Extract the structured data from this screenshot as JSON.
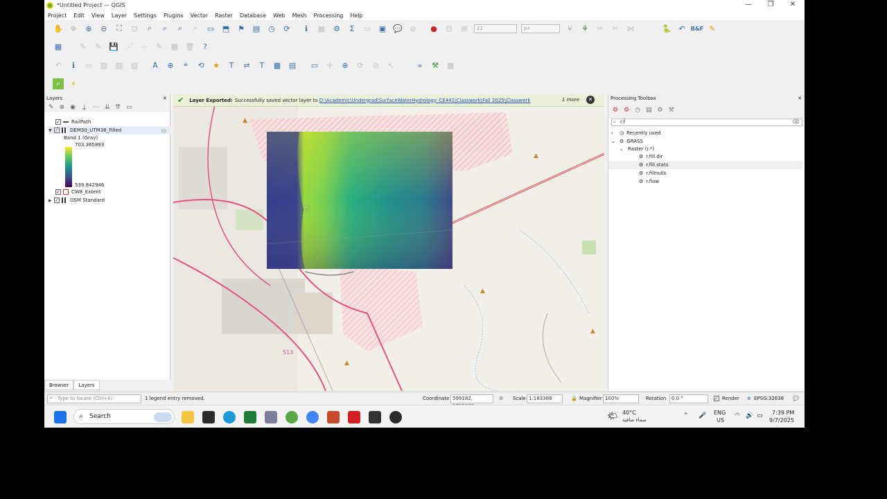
{
  "window": {
    "title": "*Untitled Project — QGIS"
  },
  "menu": [
    "Project",
    "Edit",
    "View",
    "Layer",
    "Settings",
    "Plugins",
    "Vector",
    "Raster",
    "Database",
    "Web",
    "Mesh",
    "Processing",
    "Help"
  ],
  "toolbar": {
    "font_size_value": "12",
    "unit": "px"
  },
  "layers": {
    "title": "Layers",
    "items": [
      {
        "name": "RailPath",
        "checked": true
      },
      {
        "name": "DEM30_UTM38_Filled",
        "checked": true
      },
      {
        "name": "CW8_Extent",
        "checked": true
      },
      {
        "name": "OSM Standard",
        "checked": true
      }
    ],
    "band": "Band 1 (Gray)",
    "ramp_max": "703.365893",
    "ramp_min": "539.842946"
  },
  "bottom_tabs": [
    "Browser",
    "Layers"
  ],
  "message": {
    "title": "Layer Exported:",
    "text": "Successfully saved vector layer to",
    "link": "D:\\Academic\\Undergrad\\SurfaceWaterHydrology_CE441\\Classwork\\Fall 2025\\Classwork",
    "more": "1 more"
  },
  "toolbox": {
    "title": "Processing Toolbox",
    "search": "r.f",
    "tree": [
      {
        "label": "Recently used",
        "level": 0
      },
      {
        "label": "GRASS",
        "level": 0
      },
      {
        "label": "Raster (r.*)",
        "level": 1
      },
      {
        "label": "r.fill.dir",
        "level": 2
      },
      {
        "label": "r.fill.stats",
        "level": 2
      },
      {
        "label": "r.fillnulls",
        "level": 2
      },
      {
        "label": "r.flow",
        "level": 2
      }
    ]
  },
  "status": {
    "locate_placeholder": "Type to locate (Ctrl+K)",
    "message": "1 legend entry removed.",
    "coordinate_label": "Coordinate",
    "coordinate": "599182, 2725565",
    "scale_label": "Scale",
    "scale": "1:183368",
    "magnifier_label": "Magnifier",
    "magnifier": "100%",
    "rotation_label": "Rotation",
    "rotation": "0.0 °",
    "render_label": "Render",
    "crs": "EPSG:32638"
  },
  "taskbar": {
    "search": "Search",
    "weather_temp": "40°C",
    "weather_text": "سماء صافية",
    "lang": "ENG",
    "region": "US",
    "time": "7:39 PM",
    "date": "9/7/2025"
  },
  "map_labels": {
    "route": "513"
  }
}
